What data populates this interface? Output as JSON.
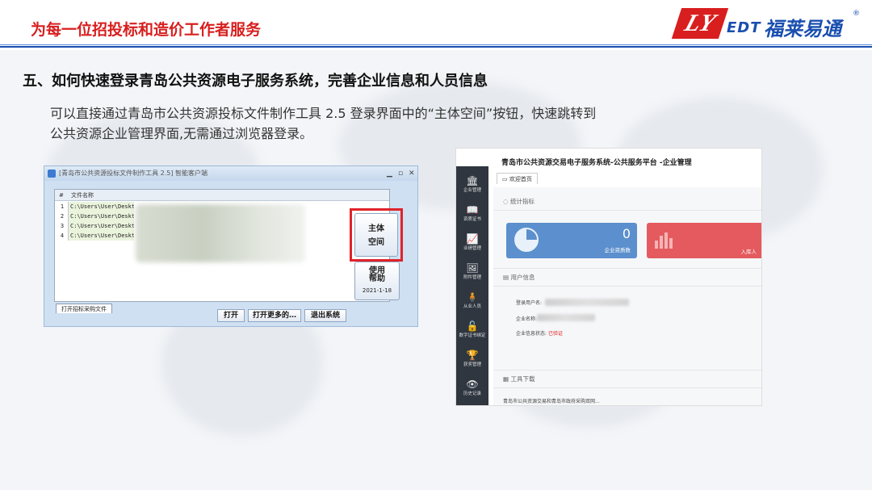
{
  "header": {
    "title": "为每一位招投标和造价工作者服务",
    "logo": {
      "mark": "LY",
      "edt": "EDT",
      "name": "福莱易通",
      "reg": "®"
    }
  },
  "section_title": "五、如何快速登录青岛公共资源电子服务系统，完善企业信息和人员信息",
  "body_lines": [
    "可以直接通过青岛市公共资源投标文件制作工具 2.5 登录界面中的“主体空间”按钮，快速跳转到",
    "公共资源企业管理界面,无需通过浏览器登录。"
  ],
  "left_window": {
    "title": "[青岛市公共资源投标文件制作工具 2.5] 智能客户端",
    "columns": {
      "num": "#",
      "name": "文件名称"
    },
    "rows": [
      {
        "num": "1",
        "path": "C:\\Users\\User\\Deskto"
      },
      {
        "num": "2",
        "path": "C:\\Users\\User\\Deskto"
      },
      {
        "num": "3",
        "path": "C:\\Users\\User\\Deskto"
      },
      {
        "num": "4",
        "path": "C:\\Users\\User\\Deskto"
      }
    ],
    "tab_label": "打开招标采购文件",
    "main_button_line1": "主体",
    "main_button_line2": "空间",
    "help_button_line1": "使用",
    "help_button_line2": "帮助",
    "help_date": "2021-1-18",
    "open_label": "打开",
    "open_more_label": "打开更多的…",
    "exit_label": "退出系统",
    "accent": "#e0222a"
  },
  "right_window": {
    "title": "青岛市公共资源交易电子服务系统-公共服务平台 -企业管理",
    "tab": "欢迎首页",
    "sidebar": [
      {
        "icon": "bank-icon",
        "glyph": "🏛",
        "label": "企业管理"
      },
      {
        "icon": "book-icon",
        "glyph": "📖",
        "label": "资质证书"
      },
      {
        "icon": "chart-icon",
        "glyph": "📈",
        "label": "业绩管理"
      },
      {
        "icon": "image-icon",
        "glyph": "🖼",
        "label": "附件管理"
      },
      {
        "icon": "person-icon",
        "glyph": "🧍",
        "label": "从业人员"
      },
      {
        "icon": "lock-icon",
        "glyph": "🔓",
        "label": "数字证书绑定"
      },
      {
        "icon": "trophy-icon",
        "glyph": "🏆",
        "label": "获奖管理"
      },
      {
        "icon": "eye-icon",
        "glyph": "👁",
        "label": "历史记录"
      }
    ],
    "stats_title": "统计指标",
    "stat_blue_value": "0",
    "stat_blue_label": "企业资质数",
    "stat_red_label": "入库人",
    "user_info_title": "用户信息",
    "login_user_label": "登录用户名:",
    "company_name_label": "企业名称:",
    "company_status_label": "企业信息状态:",
    "company_status_value": "已验证",
    "tools_title": "工具下载",
    "tools_text": "青岛市公共资源交易和青岛市政府采购双网...",
    "colors": {
      "blue": "#5b8fcd",
      "red": "#e45a5e",
      "sidebar": "#2f3640"
    }
  }
}
